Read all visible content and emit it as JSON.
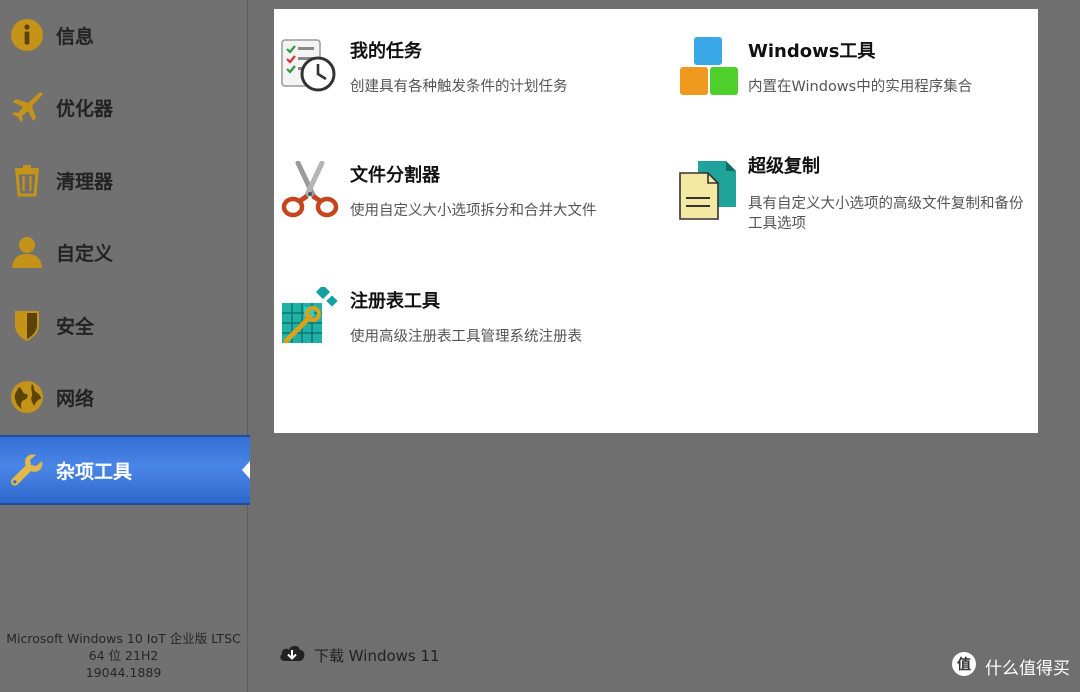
{
  "sidebar": {
    "items": [
      {
        "label": "信息",
        "icon": "info-icon"
      },
      {
        "label": "优化器",
        "icon": "airplane-icon"
      },
      {
        "label": "清理器",
        "icon": "trash-icon"
      },
      {
        "label": "自定义",
        "icon": "user-icon"
      },
      {
        "label": "安全",
        "icon": "shield-icon"
      },
      {
        "label": "网络",
        "icon": "globe-icon"
      },
      {
        "label": "杂项工具",
        "icon": "wrench-icon",
        "active": true
      }
    ],
    "system_info": {
      "line1": "Microsoft Windows 10 IoT 企业版 LTSC",
      "line2": "64 位 21H2",
      "line3": "19044.1889"
    }
  },
  "tools": [
    {
      "name": "我的任务",
      "desc": "创建具有各种触发条件的计划任务",
      "icon": "scheduled-tasks-icon"
    },
    {
      "name": "Windows工具",
      "desc": "内置在Windows中的实用程序集合",
      "icon": "windows-tools-icon"
    },
    {
      "name": "文件分割器",
      "desc": "使用自定义大小选项拆分和合并大文件",
      "icon": "scissors-icon"
    },
    {
      "name": "超级复制",
      "desc": "具有自定义大小选项的高级文件复制和备份工具选项",
      "icon": "copy-files-icon"
    },
    {
      "name": "注册表工具",
      "desc": "使用高级注册表工具管理系统注册表",
      "icon": "registry-tools-icon"
    }
  ],
  "download": {
    "label": "下载 Windows 11",
    "icon": "cloud-download-icon"
  },
  "watermark": {
    "text": "什么值得买",
    "logo": "值"
  },
  "colors": {
    "accent": "#3a78dc",
    "icon_gold": "#c49318",
    "background": "#6f6f6f",
    "panel": "#ffffff"
  }
}
